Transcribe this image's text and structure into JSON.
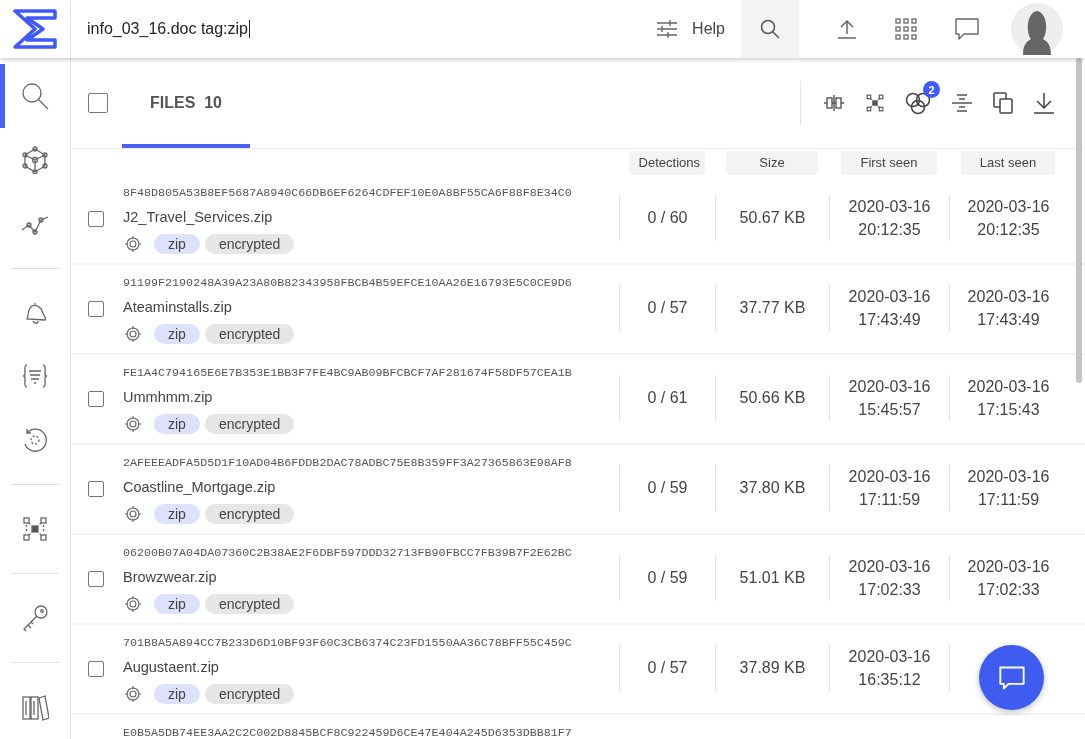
{
  "search": {
    "value": "info_03_16.doc tag:zip"
  },
  "topbar": {
    "help": "Help"
  },
  "sidebar": {
    "groups": [
      [
        {
          "kind": "search",
          "selected": true
        },
        {
          "kind": "graph",
          "selected": false
        },
        {
          "kind": "trend",
          "selected": false
        }
      ],
      [
        {
          "kind": "bell",
          "selected": false
        },
        {
          "kind": "rules",
          "selected": false
        },
        {
          "kind": "retro",
          "selected": false
        }
      ],
      [
        {
          "kind": "cluster",
          "selected": false
        }
      ],
      [
        {
          "kind": "key",
          "selected": false
        }
      ],
      [
        {
          "kind": "library",
          "selected": false
        }
      ]
    ]
  },
  "tab": {
    "label": "FILES",
    "count": "10",
    "selected": true,
    "checked": false
  },
  "toolbar": {
    "badge": "2"
  },
  "columns": [
    "Detections",
    "Size",
    "First seen",
    "Last seen"
  ],
  "rows": [
    {
      "hash": "8F48D805A53B8EF5687A8940C66DB6EF6264CDFEF10E0A8BF55CA6F88F8E34C0",
      "name": "J2_Travel_Services.zip",
      "checked": false,
      "tags": [
        {
          "label": "zip",
          "kind": "type"
        },
        {
          "label": "encrypted",
          "kind": "plain"
        }
      ],
      "detections": "0 / 60",
      "size": "50.67 KB",
      "first_seen": [
        "2020-03-16",
        "20:12:35"
      ],
      "last_seen": [
        "2020-03-16",
        "20:12:35"
      ]
    },
    {
      "hash": "91199F2190248A39A23A80B82343958FBCB4B59EFCE10AA26E16793E5C0CE9D6",
      "name": "Ateaminstalls.zip",
      "checked": false,
      "tags": [
        {
          "label": "zip",
          "kind": "type"
        },
        {
          "label": "encrypted",
          "kind": "plain"
        }
      ],
      "detections": "0 / 57",
      "size": "37.77 KB",
      "first_seen": [
        "2020-03-16",
        "17:43:49"
      ],
      "last_seen": [
        "2020-03-16",
        "17:43:49"
      ]
    },
    {
      "hash": "FE1A4C794165E6E7B353E1BB3F7FE4BC9AB09BFCBCF7AF281674F58DF57CEA1B",
      "name": "Ummhmm.zip",
      "checked": false,
      "tags": [
        {
          "label": "zip",
          "kind": "type"
        },
        {
          "label": "encrypted",
          "kind": "plain"
        }
      ],
      "detections": "0 / 61",
      "size": "50.66 KB",
      "first_seen": [
        "2020-03-16",
        "15:45:57"
      ],
      "last_seen": [
        "2020-03-16",
        "17:15:43"
      ]
    },
    {
      "hash": "2AFEEEADFA5D5D1F10AD04B6FDDB2DAC78ADBC75E8B359FF3A27365863E98AF8",
      "name": "Coastline_Mortgage.zip",
      "checked": false,
      "tags": [
        {
          "label": "zip",
          "kind": "type"
        },
        {
          "label": "encrypted",
          "kind": "plain"
        }
      ],
      "detections": "0 / 59",
      "size": "37.80 KB",
      "first_seen": [
        "2020-03-16",
        "17:11:59"
      ],
      "last_seen": [
        "2020-03-16",
        "17:11:59"
      ]
    },
    {
      "hash": "06200B07A04DA07360C2B38AE2F6DBF597DDD32713FB90FBCC7FB39B7F2E62BC",
      "name": "Browzwear.zip",
      "checked": false,
      "tags": [
        {
          "label": "zip",
          "kind": "type"
        },
        {
          "label": "encrypted",
          "kind": "plain"
        }
      ],
      "detections": "0 / 59",
      "size": "51.01 KB",
      "first_seen": [
        "2020-03-16",
        "17:02:33"
      ],
      "last_seen": [
        "2020-03-16",
        "17:02:33"
      ]
    },
    {
      "hash": "701B8A5A894CC7B233D6D10BF93F60C3CB6374C23FD1550AA36C78BFF55C459C",
      "name": "Augustaent.zip",
      "checked": false,
      "tags": [
        {
          "label": "zip",
          "kind": "type"
        },
        {
          "label": "encrypted",
          "kind": "plain"
        }
      ],
      "detections": "0 / 57",
      "size": "37.89 KB",
      "first_seen": [
        "2020-03-16",
        "16:35:12"
      ]
    },
    {
      "hash": "E0B5A5DB74EE3AA2C2C002D8845BCF8C922459D6CE47E404A245D6353DBB81F7"
    }
  ]
}
